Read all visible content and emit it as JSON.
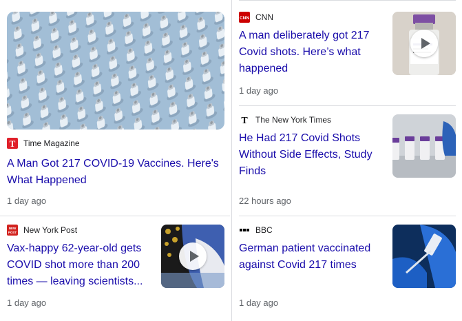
{
  "cards": [
    {
      "source": "Time Magazine",
      "source_icon": "time-magazine-logo-icon",
      "headline": "A Man Got 217 COVID-19 Vaccines. Here's What Happened",
      "time": "1 day ago"
    },
    {
      "source": "CNN",
      "source_icon": "cnn-logo-icon",
      "headline": "A man deliberately got 217 Covid shots. Here’s what happened",
      "time": "1 day ago",
      "has_video": true
    },
    {
      "source": "The New York Times",
      "source_icon": "new-york-times-logo-icon",
      "headline": "He Had 217 Covid Shots Without Side Effects, Study Finds",
      "time": "22 hours ago"
    },
    {
      "source": "New York Post",
      "source_icon": "new-york-post-logo-icon",
      "headline": "Vax-happy 62-year-old gets COVID shot more than 200 times — leaving scientists...",
      "time": "1 day ago",
      "has_video": true
    },
    {
      "source": "BBC",
      "source_icon": "bbc-logo-icon",
      "headline": "German patient vaccinated against Covid 217 times",
      "time": "1 day ago"
    }
  ],
  "colors": {
    "headline": "#1a0dab",
    "meta": "#5f6368",
    "divider": "#dadce0",
    "time_red": "#e0202a",
    "cnn_red": "#cc0000"
  }
}
